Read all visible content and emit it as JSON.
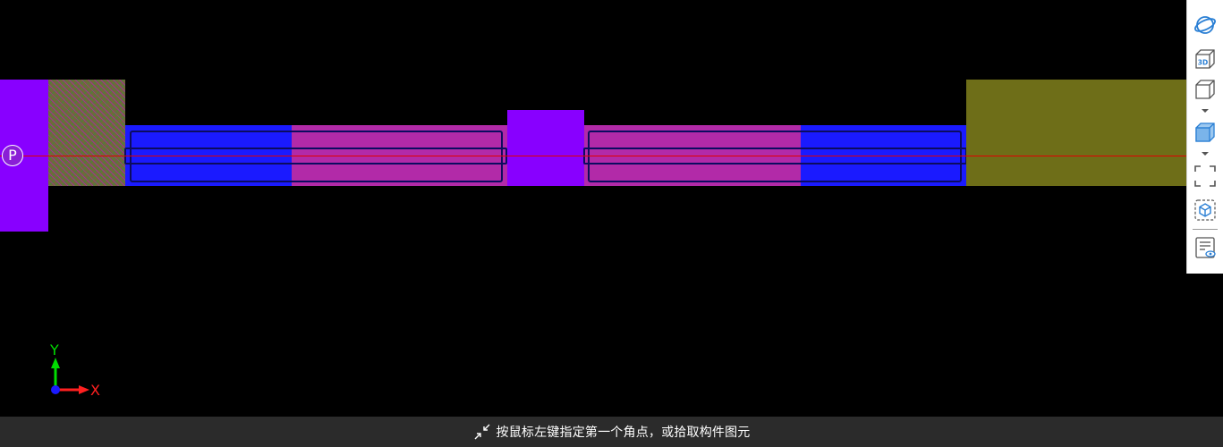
{
  "viewport": {
    "point_label": "P",
    "axis_x_label": "X",
    "axis_y_label": "Y"
  },
  "toolbar": {
    "items": [
      {
        "name": "orbit-view-icon"
      },
      {
        "name": "3d-view-icon",
        "label": "3D"
      },
      {
        "name": "wireframe-cube-icon"
      },
      {
        "name": "solid-cube-icon"
      },
      {
        "name": "zoom-extents-icon"
      },
      {
        "name": "view-selection-icon"
      },
      {
        "name": "display-settings-icon"
      }
    ]
  },
  "statusbar": {
    "icon": "shrink-arrows-icon",
    "message": "按鼠标左键指定第一个角点，或拾取构件图元"
  },
  "colors": {
    "background": "#000000",
    "column_purple": "#8800ff",
    "hatched_block": "#7a6a3a",
    "beam_blue": "#1a1aff",
    "beam_magenta": "#b22aa8",
    "olive_block": "#6e6e18",
    "axis_line": "#e00000",
    "outline": "#0c0c60",
    "axis_x": "#ff2020",
    "axis_y": "#00dd00",
    "toolbar_icon": "#2a7fd4",
    "statusbar_bg": "#2b2b2b"
  }
}
